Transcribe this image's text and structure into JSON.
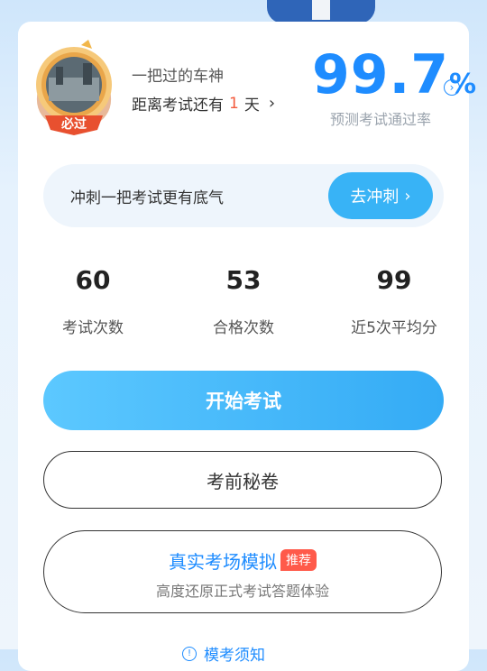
{
  "header": {
    "motto": "一把过的车神",
    "countdown_prefix": "距离考试还有",
    "countdown_days": "1",
    "countdown_suffix": "天",
    "badge_text": "必过"
  },
  "pass_rate": {
    "value": "99.7",
    "unit": "%",
    "label": "预测考试通过率"
  },
  "sprint": {
    "text": "冲刺一把考试更有底气",
    "button": "去冲刺"
  },
  "stats": [
    {
      "value": "60",
      "label": "考试次数"
    },
    {
      "value": "53",
      "label": "合格次数"
    },
    {
      "value": "99",
      "label": "近5次平均分"
    }
  ],
  "actions": {
    "start": "开始考试",
    "secret": "考前秘卷",
    "mock_title": "真实考场模拟",
    "mock_tag": "推荐",
    "mock_subtitle": "高度还原正式考试答题体验"
  },
  "footer": {
    "link": "模考须知"
  },
  "colors": {
    "accent": "#1e8cff",
    "button_blue": "#38b3f6",
    "highlight_red": "#f35a3c",
    "tag_red": "#ff5a4a"
  }
}
